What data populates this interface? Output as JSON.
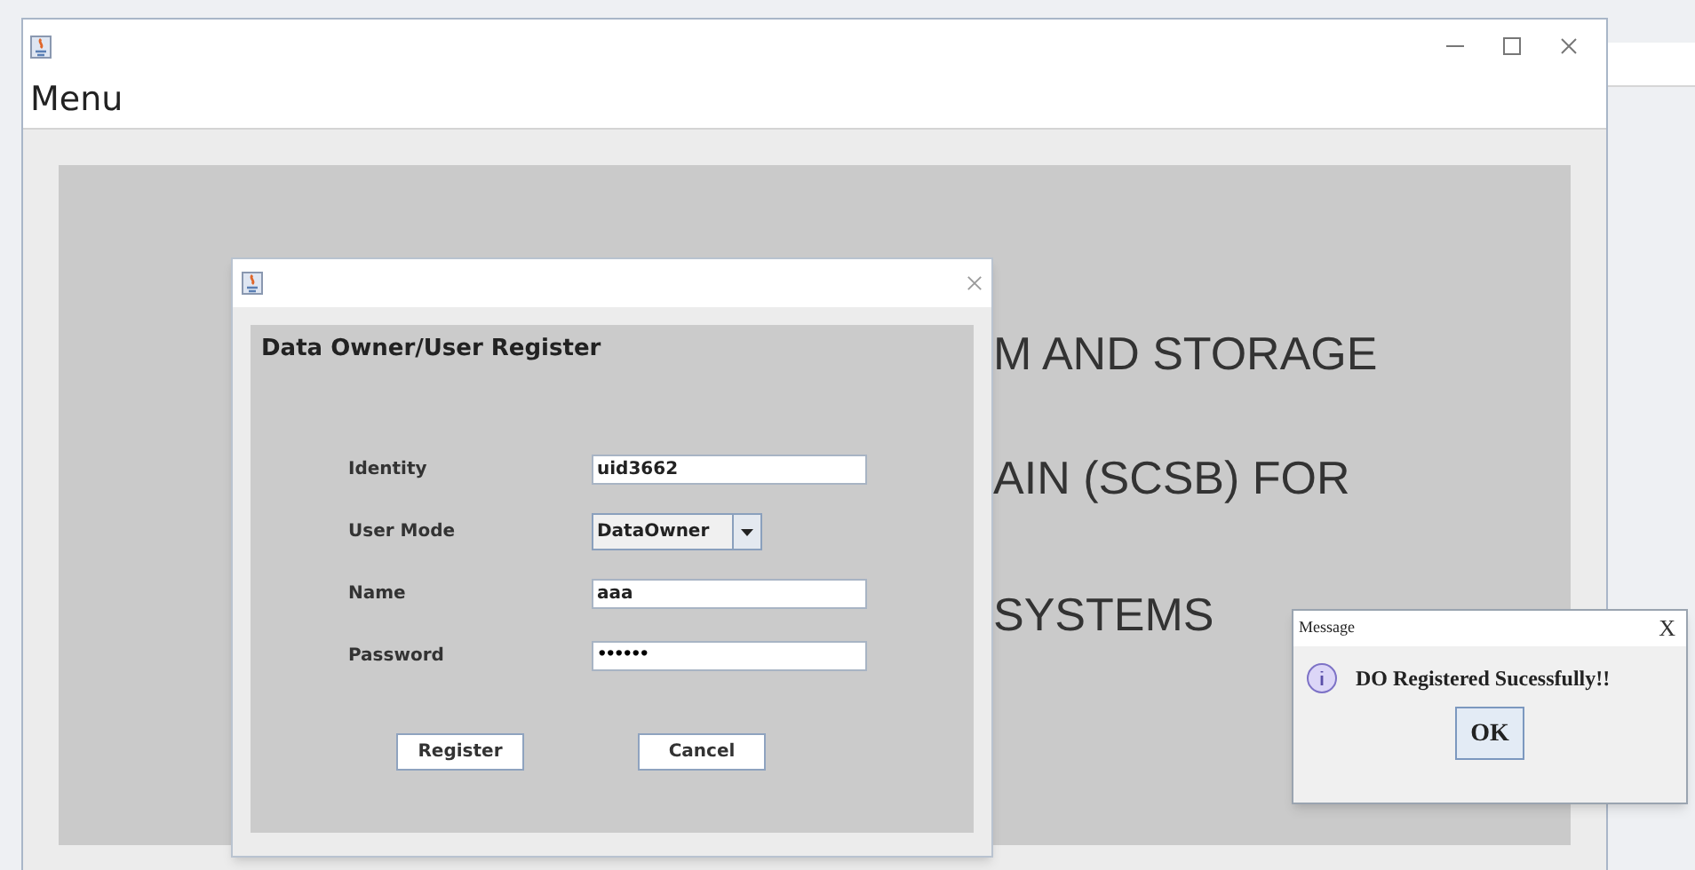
{
  "main_window": {
    "menu": [
      "Menu"
    ],
    "background_lines": [
      "M AND STORAGE",
      "AIN (SCSB) FOR",
      "SYSTEMS"
    ]
  },
  "register_dialog": {
    "heading": "Data Owner/User Register",
    "fields": [
      {
        "kind": "text",
        "label": "Identity",
        "value": "uid3662"
      },
      {
        "kind": "combo",
        "label": "User Mode",
        "value": "DataOwner"
      },
      {
        "kind": "text",
        "label": "Name",
        "value": "aaa"
      },
      {
        "kind": "password",
        "label": "Password",
        "value": "••••••"
      }
    ],
    "buttons": [
      "Register",
      "Cancel"
    ]
  },
  "message_dialog": {
    "title": "Message",
    "text": "DO Registered Sucessfully!!",
    "button": "OK",
    "close": "X"
  }
}
